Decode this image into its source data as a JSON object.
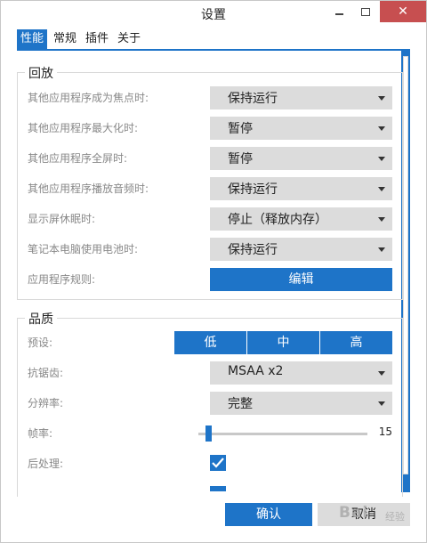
{
  "window": {
    "title": "设置",
    "close_symbol": "✕"
  },
  "tabs": [
    {
      "label": "性能",
      "active": true
    },
    {
      "label": "常规",
      "active": false
    },
    {
      "label": "插件",
      "active": false
    },
    {
      "label": "关于",
      "active": false
    }
  ],
  "playback": {
    "legend": "回放",
    "rows": [
      {
        "label": "其他应用程序成为焦点时:",
        "value": "保持运行"
      },
      {
        "label": "其他应用程序最大化时:",
        "value": "暂停"
      },
      {
        "label": "其他应用程序全屏时:",
        "value": "暂停"
      },
      {
        "label": "其他应用程序播放音频时:",
        "value": "保持运行"
      },
      {
        "label": "显示屏休眠时:",
        "value": "停止（释放内存）"
      },
      {
        "label": "笔记本电脑使用电池时:",
        "value": "保持运行"
      }
    ],
    "rules_label": "应用程序规则:",
    "rules_button": "编辑"
  },
  "quality": {
    "legend": "品质",
    "preset_label": "预设:",
    "presets": [
      "低",
      "中",
      "高"
    ],
    "antialias_label": "抗锯齿:",
    "antialias_value": "MSAA x2",
    "resolution_label": "分辨率:",
    "resolution_value": "完整",
    "framerate_label": "帧率:",
    "framerate_value": "15",
    "postprocess_label": "后处理:",
    "postprocess_checked": true
  },
  "footer": {
    "ok_label": "确认",
    "cancel_label": "取消"
  },
  "watermark": {
    "text": "Bai",
    "sub": "经验"
  },
  "colors": {
    "accent": "#1e74c8",
    "dropdown_bg": "#dcdcdc",
    "close_red": "#c74f50"
  }
}
